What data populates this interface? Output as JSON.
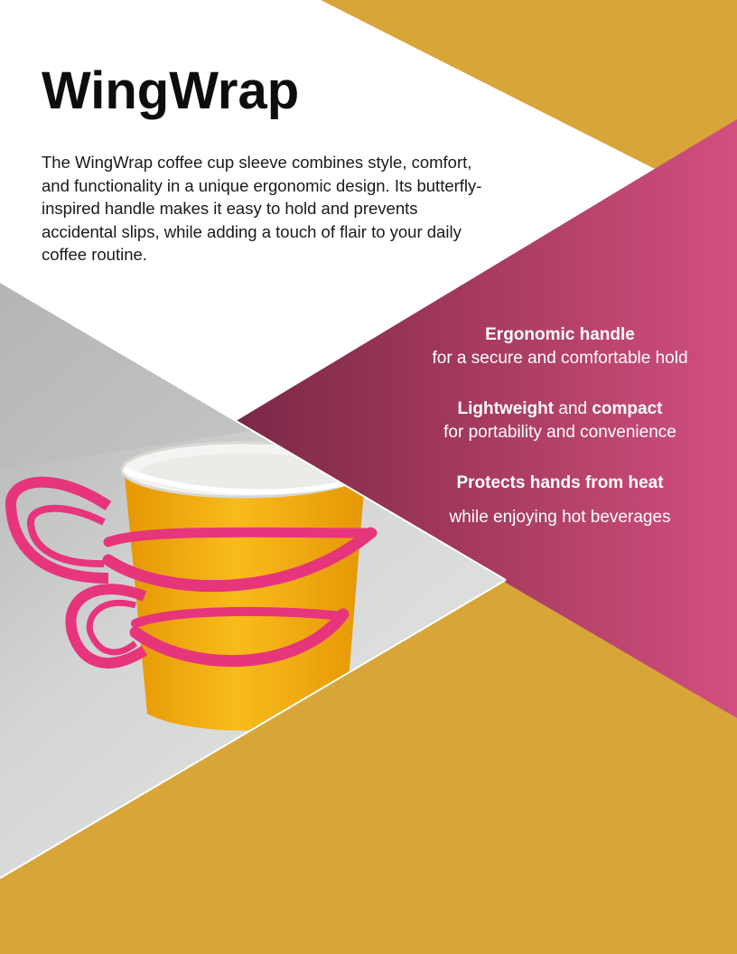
{
  "title": "WingWrap",
  "intro": "The WingWrap coffee cup sleeve combines style, comfort, and functionality in a unique ergonomic design. Its butterfly-inspired handle makes it easy to hold and prevents accidental slips, while adding a touch of flair to your daily coffee routine.",
  "features": [
    {
      "bold": "Ergonomic handle",
      "desc": "for a secure and comfortable hold"
    },
    {
      "bold_a": "Lightweight",
      "mid": " and ",
      "bold_b": "compact",
      "desc": "for portability and convenience"
    },
    {
      "bold": "Protects hands from heat",
      "desc": "while enjoying hot beverages"
    }
  ],
  "colors": {
    "gold": "#d8a638",
    "magenta": "#d24f80",
    "plum": "#7a2848",
    "text_dark": "#111111",
    "text_light": "#ffffff"
  },
  "image": {
    "subject": "yellow paper coffee cup with pink butterfly-shaped sleeve handle"
  }
}
